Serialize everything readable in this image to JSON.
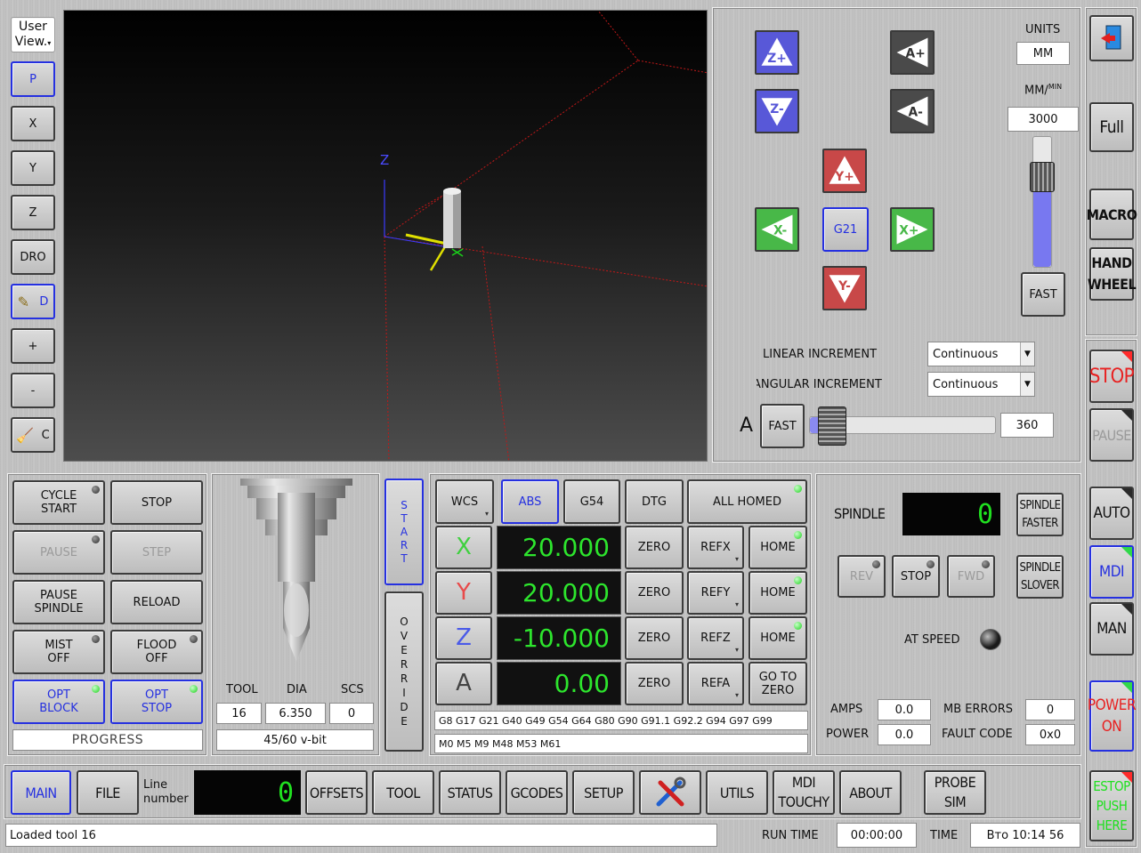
{
  "view_toolbar": {
    "user_view": "User View",
    "buttons": [
      "P",
      "X",
      "Y",
      "Z",
      "DRO",
      "D",
      "+",
      "-",
      "C"
    ]
  },
  "jog": {
    "z_plus": "Z+",
    "z_minus": "Z-",
    "a_plus": "A+",
    "a_minus": "A-",
    "y_plus": "Y+",
    "y_minus": "Y-",
    "x_plus": "X+",
    "x_minus": "X-",
    "g21": "G21",
    "units_label": "UNITS",
    "units_value": "MM",
    "rate_label": "MM/",
    "rate_sup": "MIN",
    "rate_value": "3000",
    "fast": "FAST",
    "linear_label": "LINEAR INCREMENT",
    "linear_value": "Continuous",
    "angular_label": "ANGULAR INCREMENT",
    "angular_value": "Continuous",
    "a_label": "A",
    "a_fast": "FAST",
    "a_value": "360",
    "rate_slider_level": 0.75,
    "a_slider_level": 0.05
  },
  "right_bar": {
    "exit_icon": "exit-icon",
    "full": "Full",
    "macro": "MACRO",
    "hand_wheel_1": "HAND",
    "hand_wheel_2": "WHEEL",
    "stop": "STOP",
    "pause": "PAUSE",
    "auto": "AUTO",
    "mdi": "MDI",
    "man": "MAN",
    "power_1": "POWER",
    "power_2": "ON",
    "estop_1": "ESTOP",
    "estop_2": "PUSH",
    "estop_3": "HERE"
  },
  "program": {
    "cycle_start_1": "CYCLE",
    "cycle_start_2": "START",
    "stop": "STOP",
    "pause": "PAUSE",
    "step": "STEP",
    "pause_spindle_1": "PAUSE",
    "pause_spindle_2": "SPINDLE",
    "reload": "RELOAD",
    "mist_1": "MIST",
    "mist_2": "OFF",
    "flood_1": "FLOOD",
    "flood_2": "OFF",
    "opt_block_1": "OPT",
    "opt_block_2": "BLOCK",
    "opt_stop_1": "OPT",
    "opt_stop_2": "STOP",
    "progress": "PROGRESS"
  },
  "tool": {
    "tool_label": "TOOL",
    "dia_label": "DIA",
    "scs_label": "SCS",
    "tool_value": "16",
    "dia_value": "6.350",
    "scs_value": "0",
    "description": "45/60 v-bit"
  },
  "side_tabs": {
    "start": [
      "S",
      "T",
      "A",
      "R",
      "T"
    ],
    "override": [
      "O",
      "V",
      "E",
      "R",
      "R",
      "I",
      "D",
      "E"
    ]
  },
  "dro": {
    "wcs": "WCS",
    "abs": "ABS",
    "g54": "G54",
    "dtg": "DTG",
    "all_homed": "ALL HOMED",
    "axes": [
      {
        "name": "X",
        "value": "20.000",
        "color": "#3fd03f",
        "ref": "REFX",
        "home": "HOME"
      },
      {
        "name": "Y",
        "value": "20.000",
        "color": "#e84a4a",
        "ref": "REFY",
        "home": "HOME"
      },
      {
        "name": "Z",
        "value": "-10.000",
        "color": "#4a5ae8",
        "ref": "REFZ",
        "home": "HOME"
      },
      {
        "name": "A",
        "value": "0.00",
        "color": "#444444",
        "ref": "REFA",
        "home": "GO TO ZERO"
      }
    ],
    "zero": "ZERO",
    "gcodes": "G8 G17 G21 G40 G49 G54 G64 G80 G90 G91.1 G92.2 G94 G97 G99",
    "mcodes": "M0 M5 M9 M48 M53 M61"
  },
  "spindle": {
    "label": "SPINDLE",
    "rpm": "0",
    "faster_1": "SPINDLE",
    "faster_2": "FASTER",
    "slower_1": "SPINDLE",
    "slower_2": "SLOVER",
    "rev": "REV",
    "stop": "STOP",
    "fwd": "FWD",
    "at_speed": "AT SPEED",
    "amps_label": "AMPS",
    "amps_value": "0.0",
    "power_label": "POWER",
    "power_value": "0.0",
    "mb_errors_label": "MB ERRORS",
    "mb_errors_value": "0",
    "fault_code_label": "FAULT CODE",
    "fault_code_value": "0x0"
  },
  "tabs": {
    "main": "MAIN",
    "file": "FILE",
    "line_number_1": "Line",
    "line_number_2": "number",
    "line_value": "0",
    "offsets": "OFFSETS",
    "tool": "TOOL",
    "status": "STATUS",
    "gcodes": "GCODES",
    "setup": "SETUP",
    "utils": "UTILS",
    "mdi_touchy_1": "MDI",
    "mdi_touchy_2": "TOUCHY",
    "about": "ABOUT",
    "probe_sim_1": "PROBE",
    "probe_sim_2": "SIM"
  },
  "status_bar": {
    "message": "Loaded tool 16",
    "run_time_label": "RUN TIME",
    "run_time_value": "00:00:00",
    "time_label": "TIME",
    "time_value": "Вто 10:14 56"
  },
  "preview": {
    "axis_label": "Z"
  }
}
